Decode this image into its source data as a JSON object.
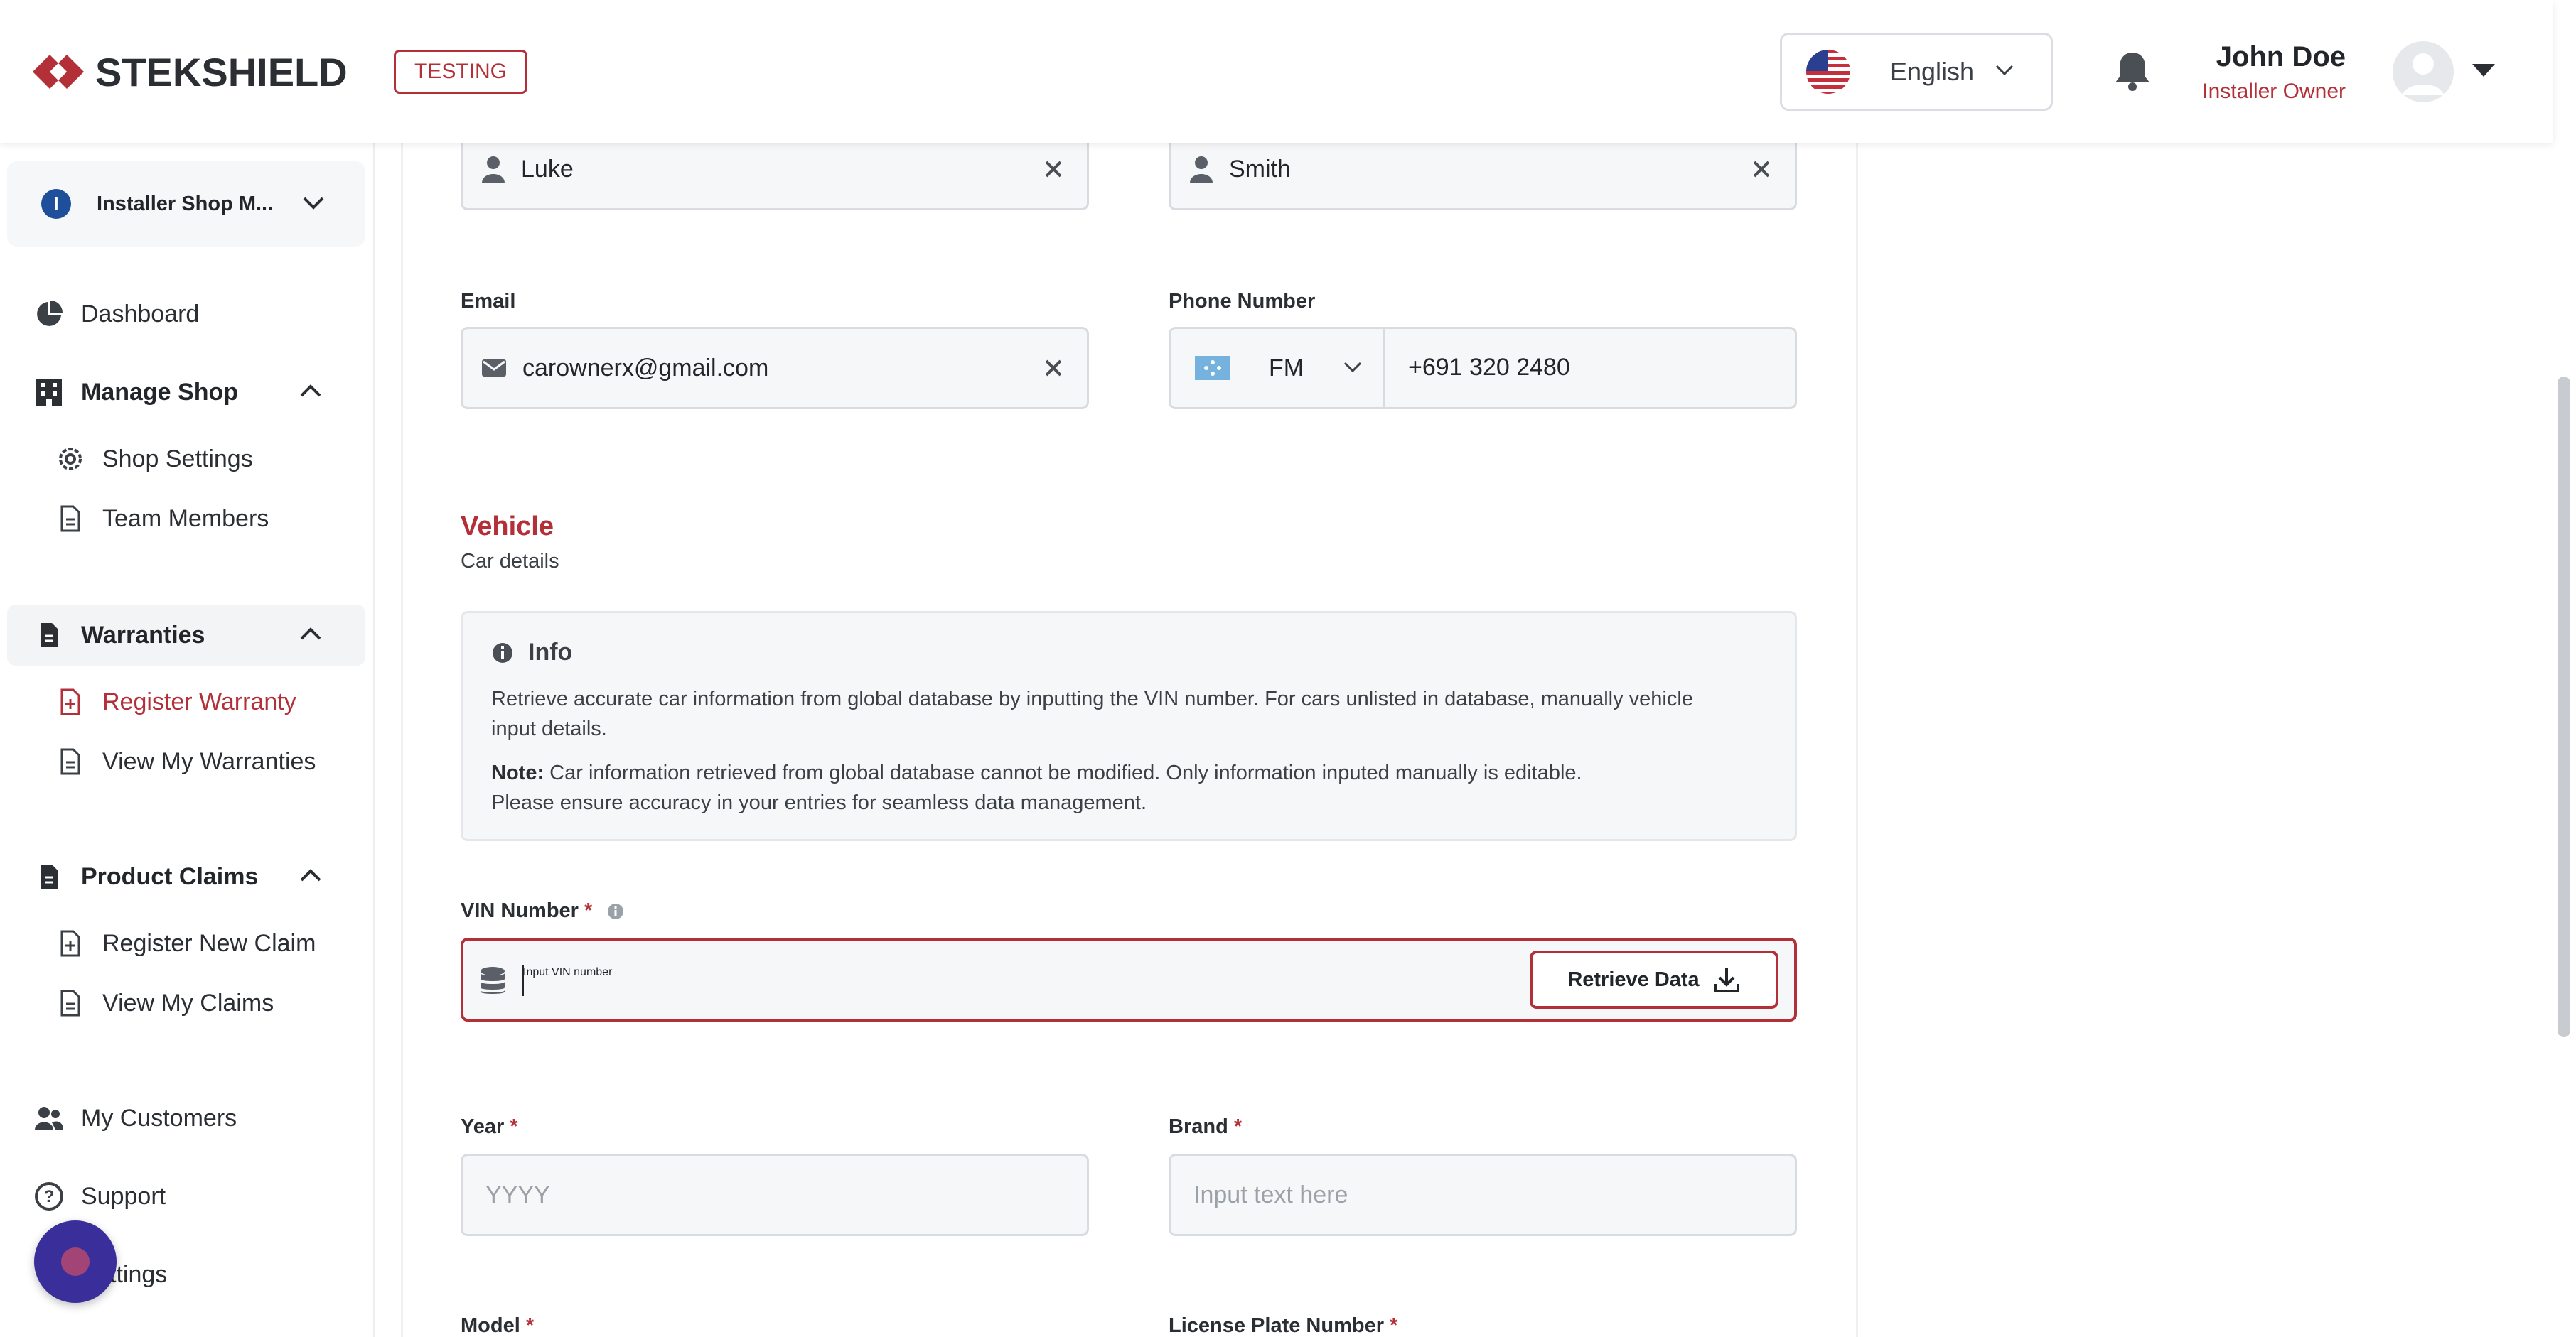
{
  "header": {
    "brand": "STEKSHIELD",
    "env_badge": "TESTING",
    "language": "English",
    "user_name": "John Doe",
    "user_role": "Installer Owner"
  },
  "sidebar": {
    "shop_initial": "I",
    "shop_name": "Installer Shop M...",
    "dashboard": "Dashboard",
    "manage_shop": "Manage Shop",
    "shop_settings": "Shop Settings",
    "team_members": "Team Members",
    "warranties": "Warranties",
    "register_warranty": "Register Warranty",
    "view_my_warranties": "View My Warranties",
    "product_claims": "Product Claims",
    "register_new_claim": "Register New Claim",
    "view_my_claims": "View My Claims",
    "my_customers": "My Customers",
    "support": "Support",
    "settings": "ttings"
  },
  "form": {
    "first_name_value": "Luke",
    "last_name_value": "Smith",
    "email_label": "Email",
    "email_value": "carownerx@gmail.com",
    "phone_label": "Phone Number",
    "phone_country": "FM",
    "phone_value": "+691 320 2480",
    "vehicle_title": "Vehicle",
    "vehicle_subtitle": "Car details",
    "info_title": "Info",
    "info_line1": "Retrieve accurate car information from global database by inputting the VIN number. For cars unlisted in database, manually vehicle",
    "info_line2": "input details.",
    "info_note_label": "Note:",
    "info_note_text": " Car information retrieved from global database cannot be modified. Only information inputed manually is editable.",
    "info_line4": "Please ensure accuracy in your entries for seamless data management.",
    "vin_label": "VIN Number",
    "vin_placeholder": "Input VIN number",
    "retrieve_label": "Retrieve Data",
    "year_label": "Year",
    "year_placeholder": "YYYY",
    "brand_label": "Brand",
    "brand_placeholder": "Input text here",
    "model_label": "Model",
    "plate_label": "License Plate Number",
    "required_mark": "*"
  },
  "colors": {
    "accent": "#b33039",
    "brand_blue": "#1d4f9b"
  }
}
